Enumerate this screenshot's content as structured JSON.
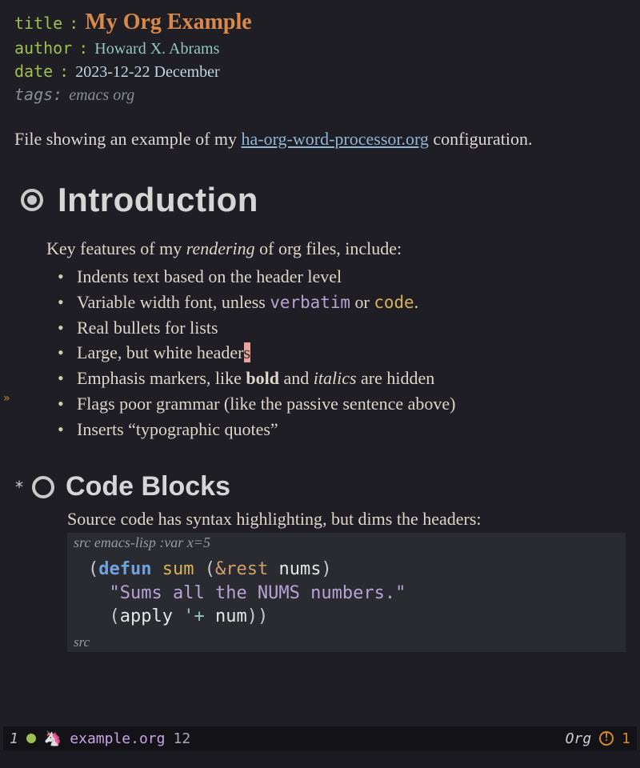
{
  "meta": {
    "title_key": "title",
    "title_val": "My Org Example",
    "author_key": "author",
    "author_val": "Howard X. Abrams",
    "date_key": "date",
    "date_val": "2023-12-22 December",
    "tags_key": "tags:",
    "tags_val": "emacs org"
  },
  "intro_para": {
    "pre": "File showing an example of my ",
    "link": "ha-org-word-processor.org",
    "post": " configuration."
  },
  "h1": "Introduction",
  "section": {
    "lead_pre": "Key features of my ",
    "lead_em": "rendering",
    "lead_post": " of org files, include:",
    "bullets": {
      "b0": "Indents text based on the header level",
      "b1_pre": "Variable width font, unless ",
      "b1_verb": "verbatim",
      "b1_mid": " or ",
      "b1_code": "code",
      "b1_post": ".",
      "b2": "Real bullets for lists",
      "b3_pre": "Large, but white header",
      "b3_cur": "s",
      "b4_pre": "Emphasis markers, like ",
      "b4_bold": "bold",
      "b4_mid": " and ",
      "b4_it": "italics",
      "b4_post": " are hidden",
      "b5": "Flags poor grammar (like the passive sentence above)",
      "b6": "Inserts “typographic quotes”"
    }
  },
  "h2_star": "*",
  "h2": "Code Blocks",
  "src": {
    "desc": "Source code has syntax highlighting, but dims the headers:",
    "begin_label": "src",
    "lang": "emacs-lisp",
    "vars": ":var x=5",
    "end_label": "src",
    "code": {
      "l1_open": "(",
      "l1_kw": "defun",
      "l1_sp1": " ",
      "l1_fn": "sum",
      "l1_sp2": " ",
      "l1_po": "(",
      "l1_amp": "&rest",
      "l1_sp3": " ",
      "l1_arg": "nums",
      "l1_pc": ")",
      "l2_str": "\"Sums all the NUMS numbers.\"",
      "l3_open": "(",
      "l3_ap": "apply",
      "l3_sp": " ",
      "l3_q": "'+",
      "l3_sp2": " ",
      "l3_n": "num",
      "l3_close": "))"
    }
  },
  "modeline": {
    "left_num": "1",
    "file": "example.org",
    "pos": "12",
    "mode": "Org",
    "warn_count": "1"
  }
}
